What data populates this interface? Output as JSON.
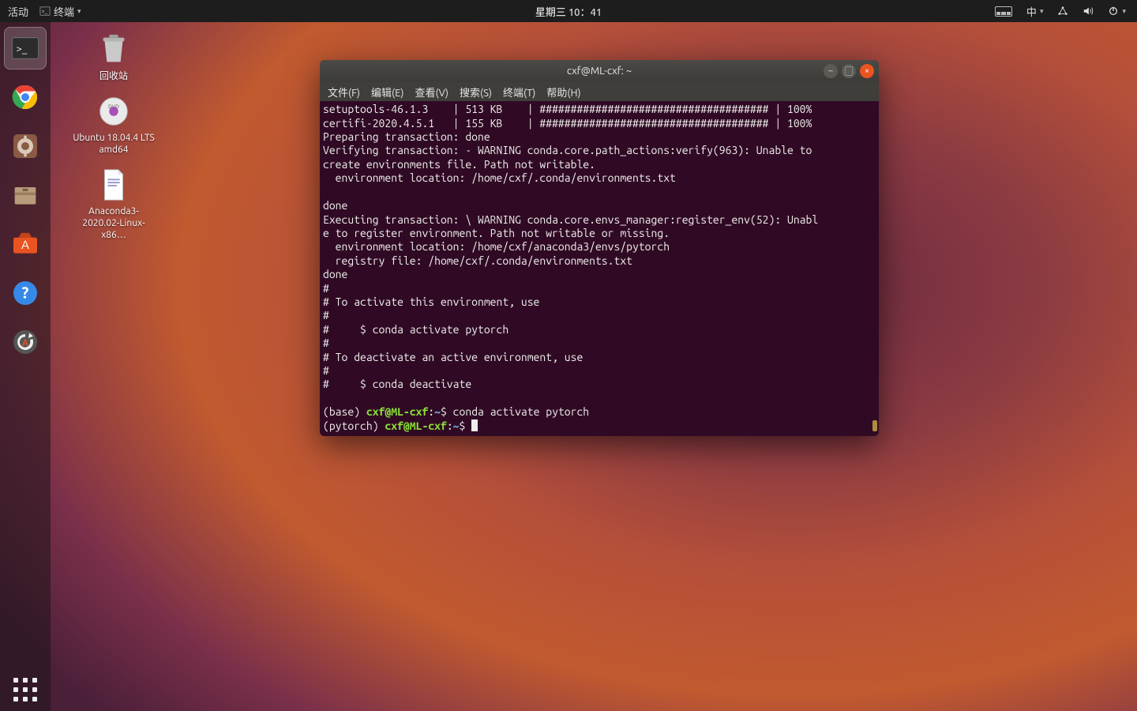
{
  "top_panel": {
    "activities": "活动",
    "app_indicator": "终端",
    "clock": "星期三 10：41",
    "ime_label": "中"
  },
  "desktop": {
    "icons": [
      {
        "name": "trash",
        "label": "回收站"
      },
      {
        "name": "iso",
        "label": "Ubuntu 18.04.4 LTS amd64"
      },
      {
        "name": "anaconda",
        "label": "Anaconda3-2020.02-Linux-x86…"
      }
    ]
  },
  "dock": {
    "items": [
      {
        "name": "terminal",
        "active": true
      },
      {
        "name": "chrome"
      },
      {
        "name": "settings-tool"
      },
      {
        "name": "files"
      },
      {
        "name": "software-center"
      },
      {
        "name": "help"
      },
      {
        "name": "software-updater"
      }
    ]
  },
  "window": {
    "title": "cxf@ML-cxf: ~",
    "menu": [
      "文件(F)",
      "编辑(E)",
      "查看(V)",
      "搜索(S)",
      "终端(T)",
      "帮助(H)"
    ]
  },
  "terminal": {
    "lines": [
      "setuptools-46.1.3    | 513 KB    | ##################################### | 100%",
      "certifi-2020.4.5.1   | 155 KB    | ##################################### | 100%",
      "Preparing transaction: done",
      "Verifying transaction: - WARNING conda.core.path_actions:verify(963): Unable to",
      "create environments file. Path not writable.",
      "  environment location: /home/cxf/.conda/environments.txt",
      "",
      "done",
      "Executing transaction: \\ WARNING conda.core.envs_manager:register_env(52): Unabl",
      "e to register environment. Path not writable or missing.",
      "  environment location: /home/cxf/anaconda3/envs/pytorch",
      "  registry file: /home/cxf/.conda/environments.txt",
      "done",
      "#",
      "# To activate this environment, use",
      "#",
      "#     $ conda activate pytorch",
      "#",
      "# To deactivate an active environment, use",
      "#",
      "#     $ conda deactivate",
      ""
    ],
    "prompt1": {
      "env": "(base) ",
      "userhost": "cxf@ML-cxf",
      "sep": ":",
      "path": "~",
      "sym": "$ ",
      "cmd": "conda activate pytorch"
    },
    "prompt2": {
      "env": "(pytorch) ",
      "userhost": "cxf@ML-cxf",
      "sep": ":",
      "path": "~",
      "sym": "$ "
    }
  }
}
